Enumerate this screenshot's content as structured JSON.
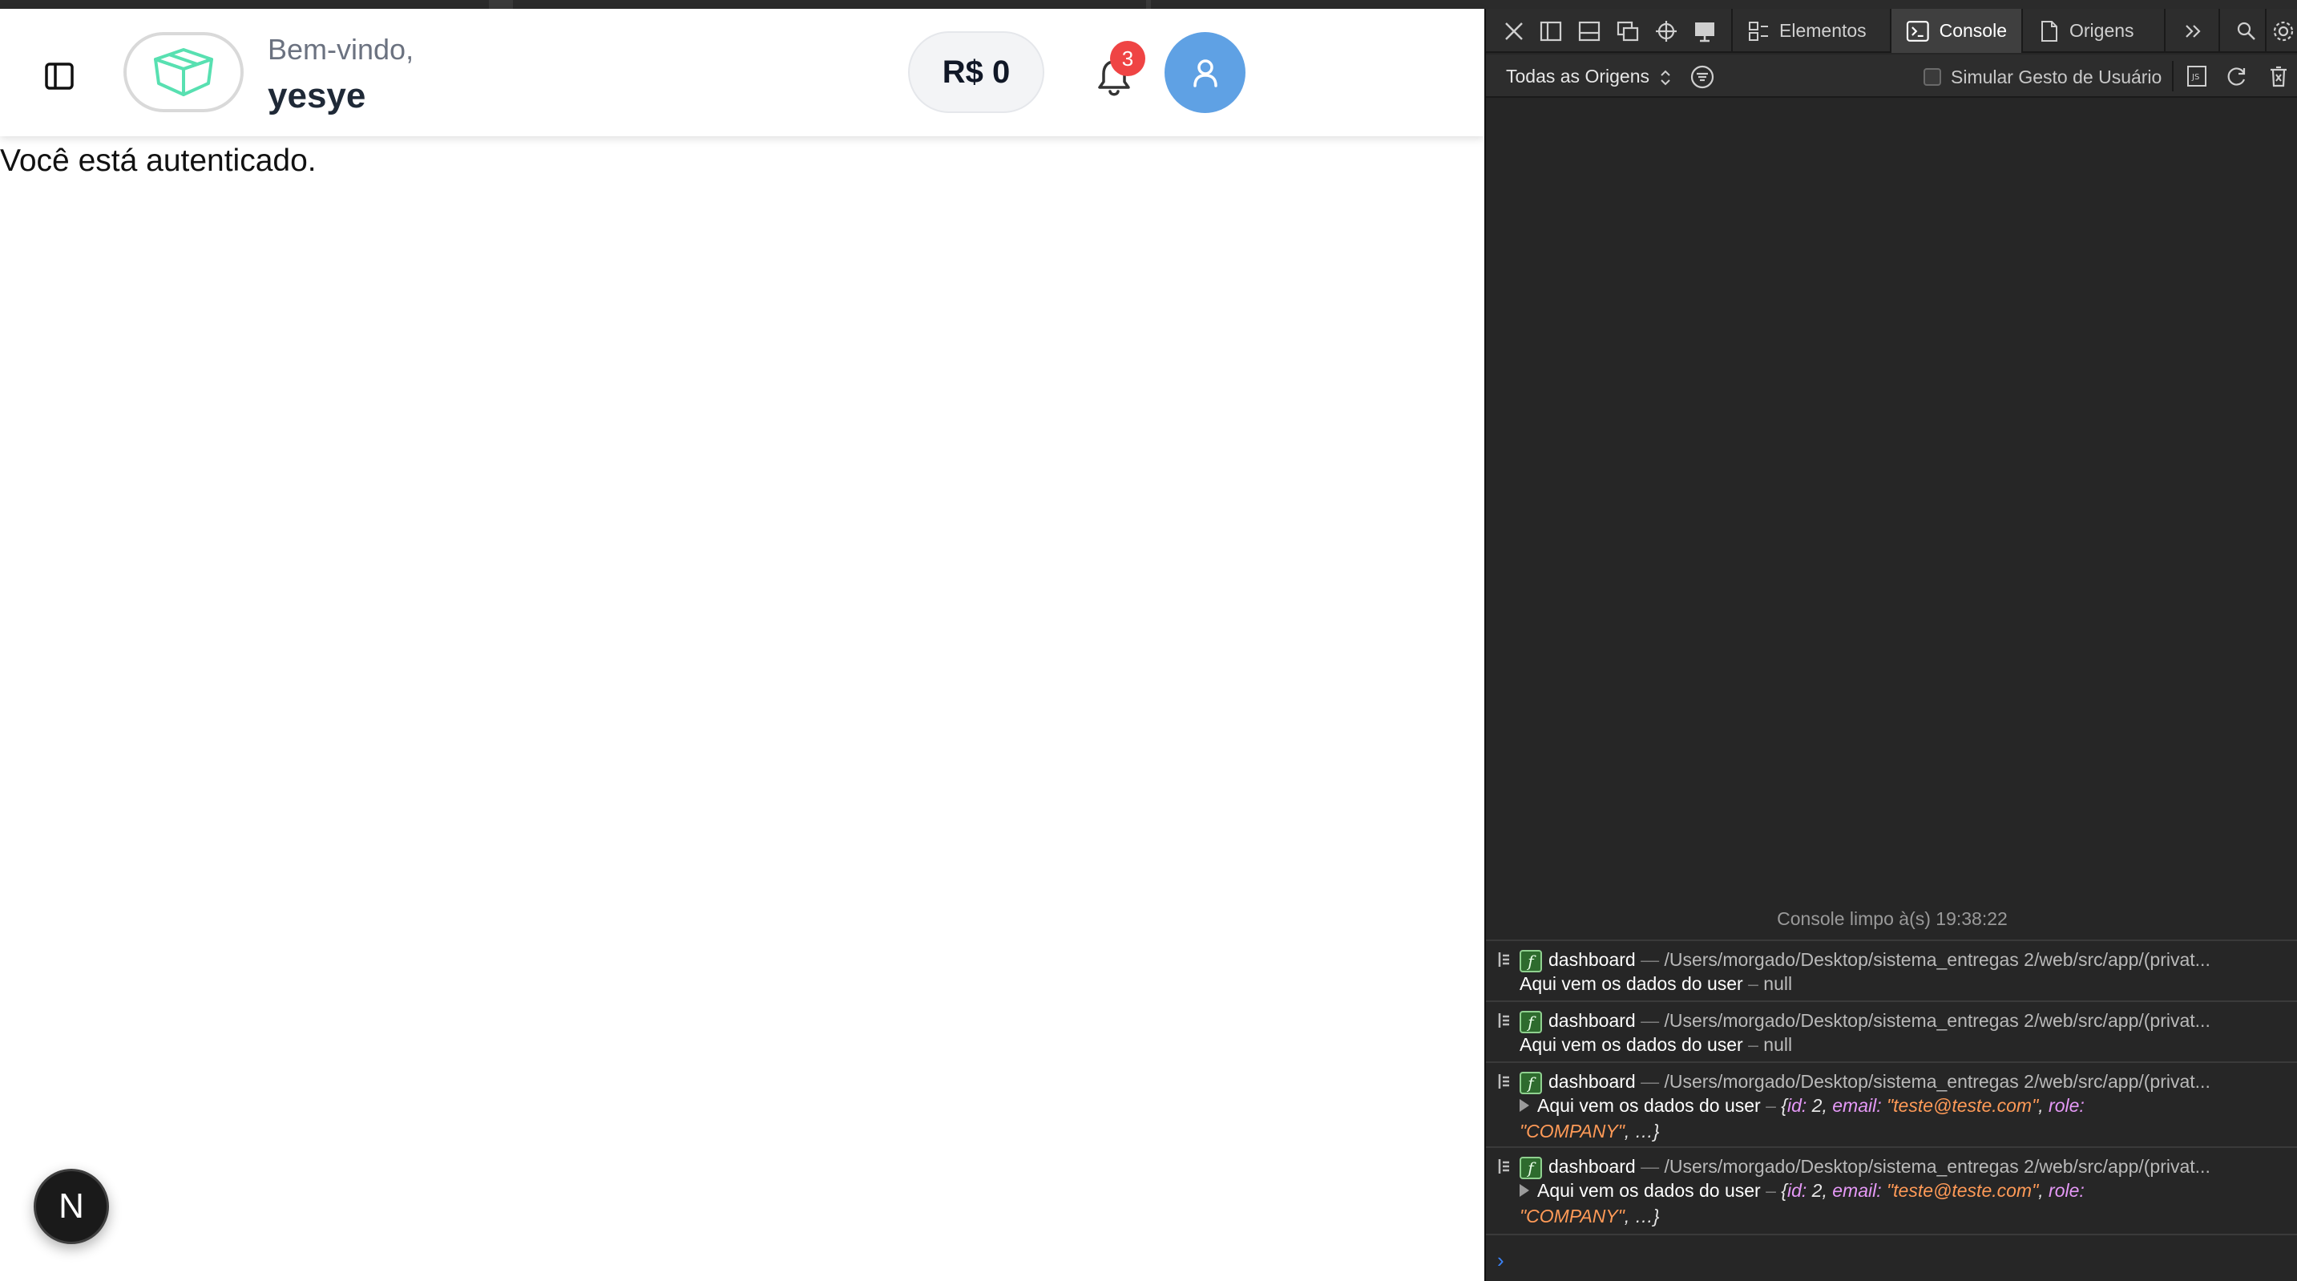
{
  "header": {
    "welcome": "Bem-vindo,",
    "username": "yesye",
    "balance": "R$ 0",
    "notification_count": "3"
  },
  "main": {
    "auth_message": "Você está autenticado."
  },
  "next_button": {
    "label": "N"
  },
  "devtools": {
    "tabs": [
      {
        "label": "Elementos",
        "icon": "elements-icon"
      },
      {
        "label": "Console",
        "icon": "console-icon"
      },
      {
        "label": "Origens",
        "icon": "sources-icon"
      }
    ],
    "filter": {
      "origins_label": "Todas as Origens",
      "simulate_label": "Simular Gesto de Usuário"
    },
    "console_cleared": "Console limpo à(s) 19:38:22",
    "logs": [
      {
        "fn": "f",
        "name": "dashboard",
        "sep": "—",
        "path": "/Users/morgado/Desktop/sistema_entregas 2/web/src/app/(privat...",
        "message": "Aqui vem os dados do user",
        "dash": "–",
        "value": "null"
      },
      {
        "fn": "f",
        "name": "dashboard",
        "sep": "—",
        "path": "/Users/morgado/Desktop/sistema_entregas 2/web/src/app/(privat...",
        "message": "Aqui vem os dados do user",
        "dash": "–",
        "value": "null"
      },
      {
        "fn": "f",
        "name": "dashboard",
        "sep": "—",
        "path": "/Users/morgado/Desktop/sistema_entregas 2/web/src/app/(privat...",
        "message": "Aqui vem os dados do user",
        "dash": "–",
        "obj_open": "{",
        "k_id": "id:",
        "v_id": "2,",
        "k_email": "email:",
        "v_email": "\"teste@teste.com\"",
        "comma": ",",
        "k_role": "role:",
        "v_role": "\"COMPANY\"",
        "obj_close": ", …}"
      },
      {
        "fn": "f",
        "name": "dashboard",
        "sep": "—",
        "path": "/Users/morgado/Desktop/sistema_entregas 2/web/src/app/(privat...",
        "message": "Aqui vem os dados do user",
        "dash": "–",
        "obj_open": "{",
        "k_id": "id:",
        "v_id": "2,",
        "k_email": "email:",
        "v_email": "\"teste@teste.com\"",
        "comma": ",",
        "k_role": "role:",
        "v_role": "\"COMPANY\"",
        "obj_close": ", …}"
      }
    ],
    "prompt": "›"
  }
}
